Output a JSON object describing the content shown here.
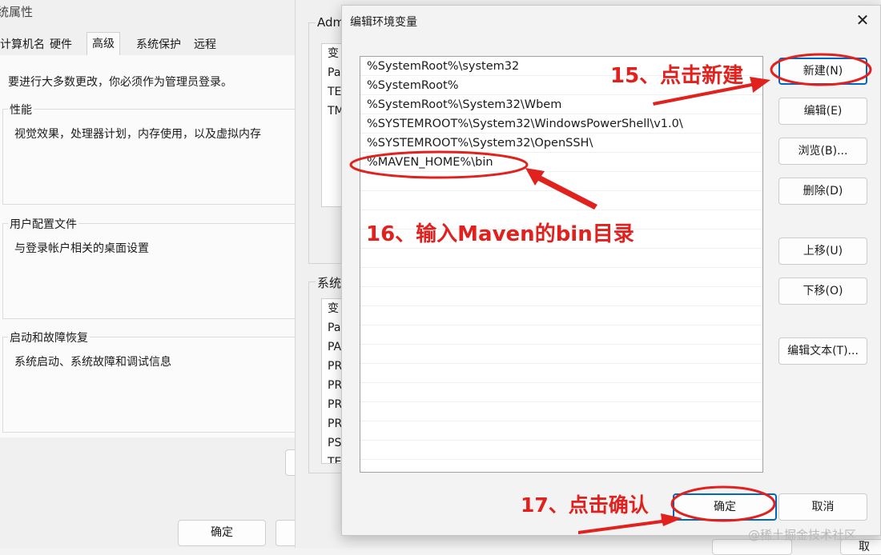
{
  "system_properties": {
    "title": "统属性",
    "tabs": [
      "计算机名",
      "硬件",
      "高级",
      "系统保护",
      "远程"
    ],
    "active_tab": "高级",
    "admin_note": "要进行大多数更改，你必须作为管理员登录。",
    "groups": [
      {
        "label": "性能",
        "desc": "视觉效果，处理器计划，内存使用，以及虚拟内存"
      },
      {
        "label": "用户配置文件",
        "desc": "与登录帐户相关的桌面设置"
      },
      {
        "label": "启动和故障恢复",
        "desc": "系统启动、系统故障和调试信息"
      }
    ],
    "ok_label": "确定"
  },
  "env_window": {
    "user_group_label": "Adm",
    "user_vars": [
      "变",
      "Pa",
      "TE",
      "TM"
    ],
    "system_group_label": "系统",
    "system_vars": [
      "变",
      "Pa",
      "PA",
      "PR",
      "PR",
      "PR",
      "PR",
      "PS",
      "TE"
    ],
    "bottom_button_fragment": "取"
  },
  "dialog": {
    "title": "编辑环境变量",
    "close_glyph": "✕",
    "paths": [
      "%SystemRoot%\\system32",
      "%SystemRoot%",
      "%SystemRoot%\\System32\\Wbem",
      "%SYSTEMROOT%\\System32\\WindowsPowerShell\\v1.0\\",
      "%SYSTEMROOT%\\System32\\OpenSSH\\",
      "%MAVEN_HOME%\\bin"
    ],
    "buttons": {
      "new": "新建(N)",
      "edit": "编辑(E)",
      "browse": "浏览(B)...",
      "delete": "删除(D)",
      "move_up": "上移(U)",
      "move_down": "下移(O)",
      "edit_text": "编辑文本(T)...",
      "ok": "确定",
      "cancel": "取消"
    }
  },
  "annotations": {
    "step15": "15、点击新建",
    "step16": "16、输入Maven的bin目录",
    "step17": "17、点击确认",
    "color": "#e0211e"
  },
  "watermark": "@稀土掘金技术社区"
}
